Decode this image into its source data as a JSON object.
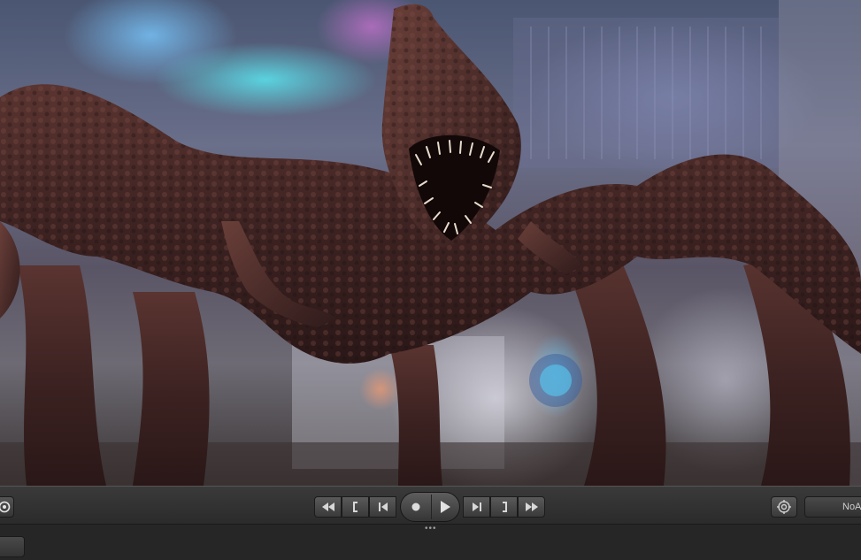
{
  "viewport": {
    "subject": "creature-render"
  },
  "toolbar": {
    "buttons": [
      {
        "name": "jump-to-start-button",
        "icon": "rewind-icon"
      },
      {
        "name": "previous-key-button",
        "icon": "left-bracket-icon"
      },
      {
        "name": "step-back-button",
        "icon": "step-back-icon"
      },
      {
        "name": "record-button",
        "icon": "record-icon"
      },
      {
        "name": "play-button",
        "icon": "play-icon"
      },
      {
        "name": "step-forward-button",
        "icon": "step-forward-icon"
      },
      {
        "name": "next-key-button",
        "icon": "right-bracket-icon"
      },
      {
        "name": "jump-to-end-button",
        "icon": "fast-forward-icon"
      }
    ],
    "audio_label": "NoAudio",
    "accent": "#d8d8d8"
  }
}
